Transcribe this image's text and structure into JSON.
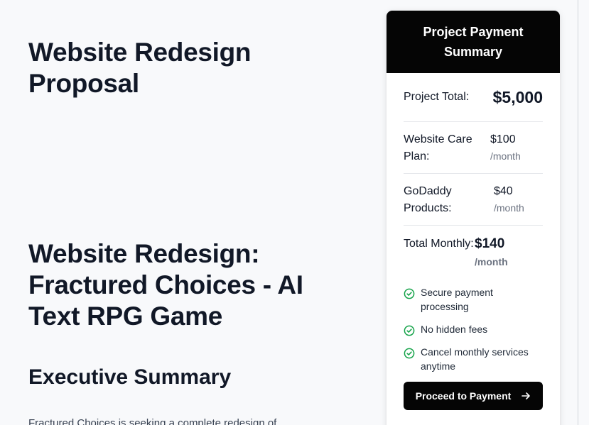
{
  "document": {
    "title": "Website Redesign Proposal",
    "section_title": "Website Redesign: Fractured Choices - AI Text RPG Game",
    "executive_summary_heading": "Executive Summary",
    "executive_summary_text": "Fractured Choices is seeking a complete redesign of"
  },
  "summary_card": {
    "title": "Project Payment Summary",
    "project_total_label": "Project Total:",
    "project_total_value": "$5,000",
    "care_plan_label": "Website Care Plan:",
    "care_plan_price": "$100",
    "care_plan_period": "/month",
    "godaddy_label": "GoDaddy Products:",
    "godaddy_price": "$40",
    "godaddy_period": "/month",
    "total_monthly_label": "Total Monthly:",
    "total_monthly_price": "$140",
    "total_monthly_period": "/month",
    "features": [
      "Secure payment processing",
      "No hidden fees",
      "Cancel monthly services anytime"
    ],
    "pay_button_label": "Proceed to Payment",
    "icons": {
      "feature": "check-circle-icon",
      "button": "arrow-right-icon"
    },
    "colors": {
      "header_bg": "#050505",
      "check": "#16a34a"
    }
  }
}
